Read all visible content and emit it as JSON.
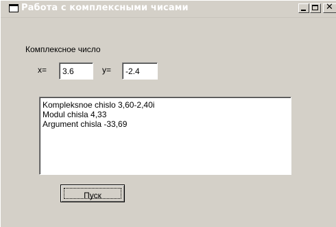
{
  "window": {
    "title": "Работа с комплексными чисами",
    "buttons": {
      "minimize_icon": "minimize-icon",
      "maximize_icon": "maximize-icon",
      "close_icon": "close-icon"
    }
  },
  "form": {
    "group_label": "Комплексное число",
    "x_label": "x=",
    "x_value": "3.6",
    "y_label": "y=",
    "y_value": "-2.4",
    "output_lines": [
      "Kompleksnoe chislo 3,60-2,40i",
      "Modul chisla 4,33",
      "Argument chisla -33,69"
    ],
    "run_button_label": "Пуск"
  },
  "colors": {
    "window_face": "#d4d0c8",
    "title_text": "#ffffff"
  }
}
